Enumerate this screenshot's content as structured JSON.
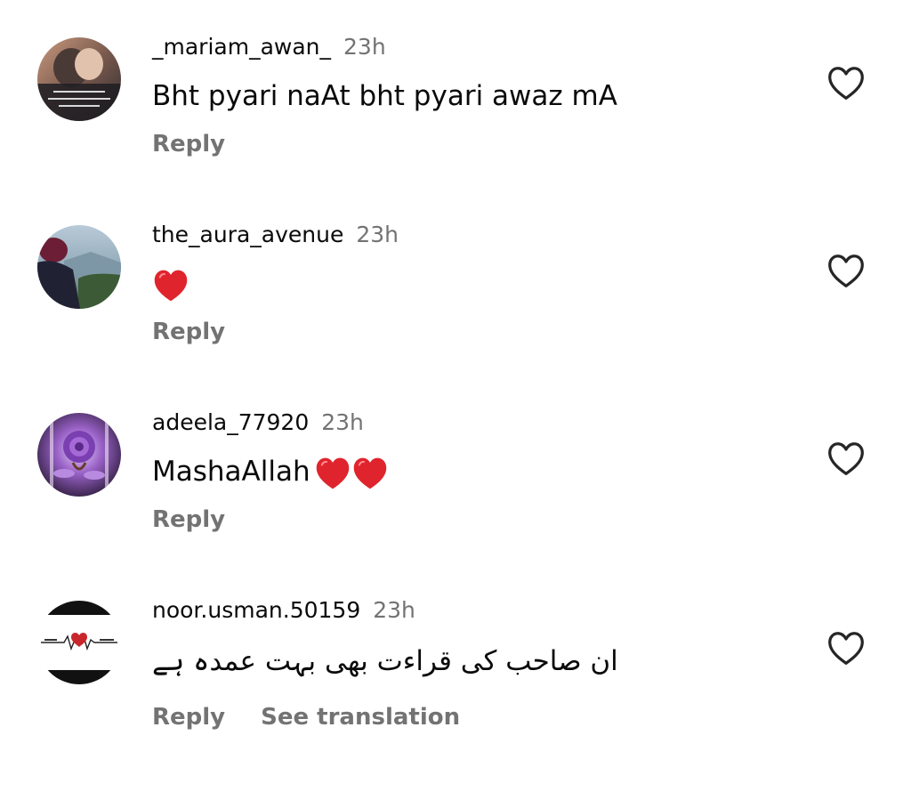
{
  "comments": [
    {
      "username": "_mariam_awan_",
      "time": "23h",
      "text": "Bht pyari naAt bht pyari awaz mA",
      "emoji_count": 0,
      "reply_label": "Reply"
    },
    {
      "username": "the_aura_avenue",
      "time": "23h",
      "text": "",
      "emoji": "❤️",
      "emoji_count": 1,
      "reply_label": "Reply"
    },
    {
      "username": "adeela_77920",
      "time": "23h",
      "text": "MashaAllah",
      "emoji": "❤️❤️",
      "emoji_count": 2,
      "reply_label": "Reply"
    },
    {
      "username": "noor.usman.50159",
      "time": "23h",
      "text": "ان صاحب کی قراءت بھی بہت عمدہ ہے",
      "emoji_count": 0,
      "reply_label": "Reply",
      "translate_label": "See translation"
    }
  ],
  "icons": {
    "like": "heart-outline-icon"
  },
  "colors": {
    "text": "#0a0a0a",
    "secondary": "#737373",
    "heart_emoji": "#e0242d"
  }
}
